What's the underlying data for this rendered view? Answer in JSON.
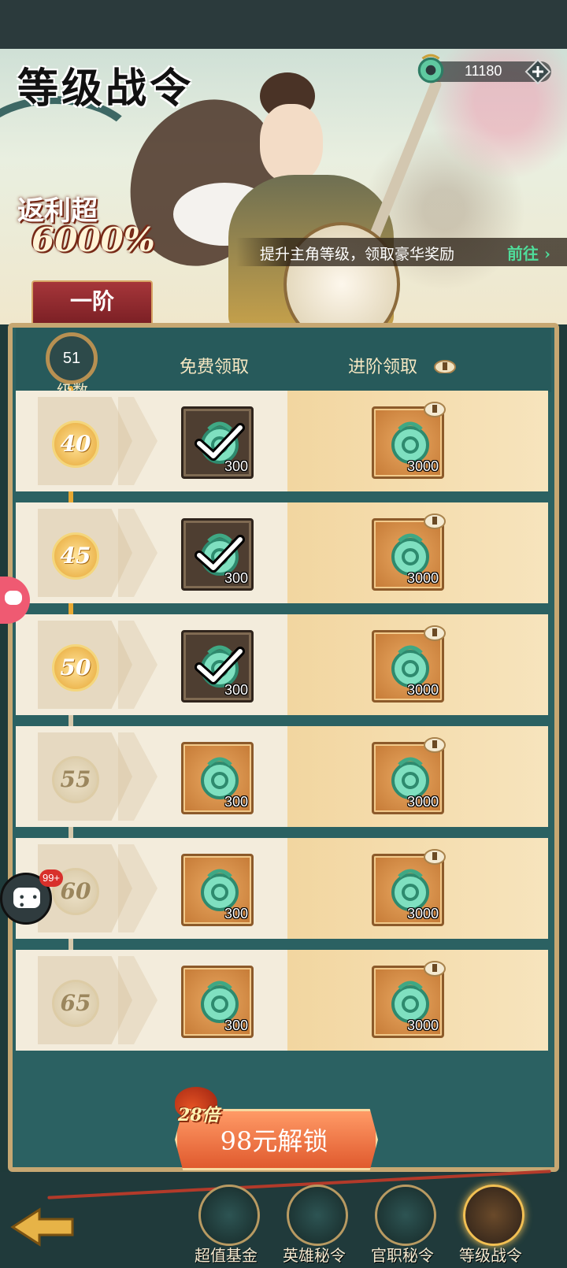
{
  "header": {
    "title": "等级战令",
    "rebate_label": "返利超",
    "rebate_value": "6000%",
    "currency_amount": "11180",
    "promo_text": "提升主角等级，领取豪华奖励",
    "promo_link": "前往"
  },
  "tabs": [
    {
      "label": "一阶",
      "active": true
    }
  ],
  "progress": {
    "current_level": "51",
    "level_label": "级数"
  },
  "columns": {
    "free": "免费领取",
    "advanced": "进阶领取"
  },
  "rows": [
    {
      "level": "40",
      "reached": true,
      "free_qty": "300",
      "free_claimed": true,
      "adv_qty": "3000",
      "adv_locked": true
    },
    {
      "level": "45",
      "reached": true,
      "free_qty": "300",
      "free_claimed": true,
      "adv_qty": "3000",
      "adv_locked": true
    },
    {
      "level": "50",
      "reached": true,
      "free_qty": "300",
      "free_claimed": true,
      "adv_qty": "3000",
      "adv_locked": true
    },
    {
      "level": "55",
      "reached": false,
      "free_qty": "300",
      "free_claimed": false,
      "adv_qty": "3000",
      "adv_locked": true
    },
    {
      "level": "60",
      "reached": false,
      "free_qty": "300",
      "free_claimed": false,
      "adv_qty": "3000",
      "adv_locked": true
    },
    {
      "level": "65",
      "reached": false,
      "free_qty": "300",
      "free_claimed": false,
      "adv_qty": "3000",
      "adv_locked": true
    }
  ],
  "unlock": {
    "multiplier": "28倍",
    "label": "98元解锁"
  },
  "bottom_nav": [
    {
      "label": "超值基金",
      "icon": "jade-dragon-icon",
      "active": false
    },
    {
      "label": "英雄秘令",
      "icon": "jade-dragon-icon",
      "active": false
    },
    {
      "label": "官职秘令",
      "icon": "official-seal-icon",
      "active": false
    },
    {
      "label": "等级战令",
      "icon": "treasure-chest-icon",
      "active": true
    }
  ],
  "floating": {
    "chat_badge": "99+"
  },
  "colors": {
    "panel_bg": "#2b6162",
    "gold_accent": "#e8a933",
    "tab_red": "#a6363a",
    "unlock_orange": "#e05a2e",
    "promo_link_green": "#4fdc9a"
  }
}
